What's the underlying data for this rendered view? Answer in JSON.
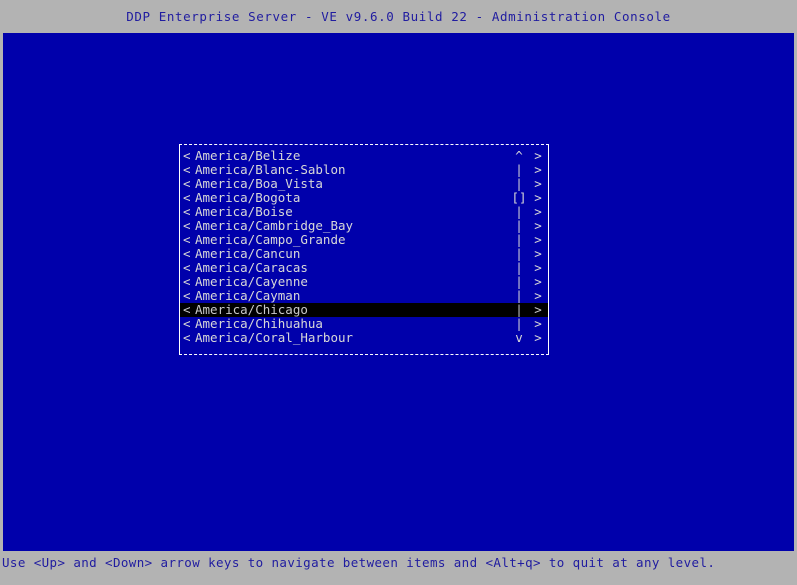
{
  "window": {
    "title": "DDP Enterprise Server - VE v9.6.0 Build 22 - Administration Console"
  },
  "colors": {
    "chrome_background": "#b3b3b3",
    "terminal_background": "#0000ab",
    "title_text": "#201ca0",
    "list_text": "#d8d8d8",
    "list_border": "#ffffff",
    "selection_background": "#000000",
    "selection_text": "#c9c9c9",
    "status_text": "#201ca0"
  },
  "list": {
    "left_marker": "<",
    "right_marker": ">",
    "scroll_up_icon": "^",
    "scroll_down_icon": "v",
    "scroll_track_icon": "|",
    "scroll_thumb_icon": "[]",
    "selected_index": 11,
    "items": [
      {
        "label": "America/Belize",
        "scroll": "^"
      },
      {
        "label": "America/Blanc-Sablon",
        "scroll": "|"
      },
      {
        "label": "America/Boa_Vista",
        "scroll": "|"
      },
      {
        "label": "America/Bogota",
        "scroll": "[]"
      },
      {
        "label": "America/Boise",
        "scroll": "|"
      },
      {
        "label": "America/Cambridge_Bay",
        "scroll": "|"
      },
      {
        "label": "America/Campo_Grande",
        "scroll": "|"
      },
      {
        "label": "America/Cancun",
        "scroll": "|"
      },
      {
        "label": "America/Caracas",
        "scroll": "|"
      },
      {
        "label": "America/Cayenne",
        "scroll": "|"
      },
      {
        "label": "America/Cayman",
        "scroll": "|"
      },
      {
        "label": "America/Chicago",
        "scroll": "|"
      },
      {
        "label": "America/Chihuahua",
        "scroll": "|"
      },
      {
        "label": "America/Coral_Harbour",
        "scroll": "v"
      }
    ]
  },
  "status": {
    "hint": "Use <Up> and <Down> arrow keys to navigate between items and <Alt+q> to quit at any level."
  }
}
